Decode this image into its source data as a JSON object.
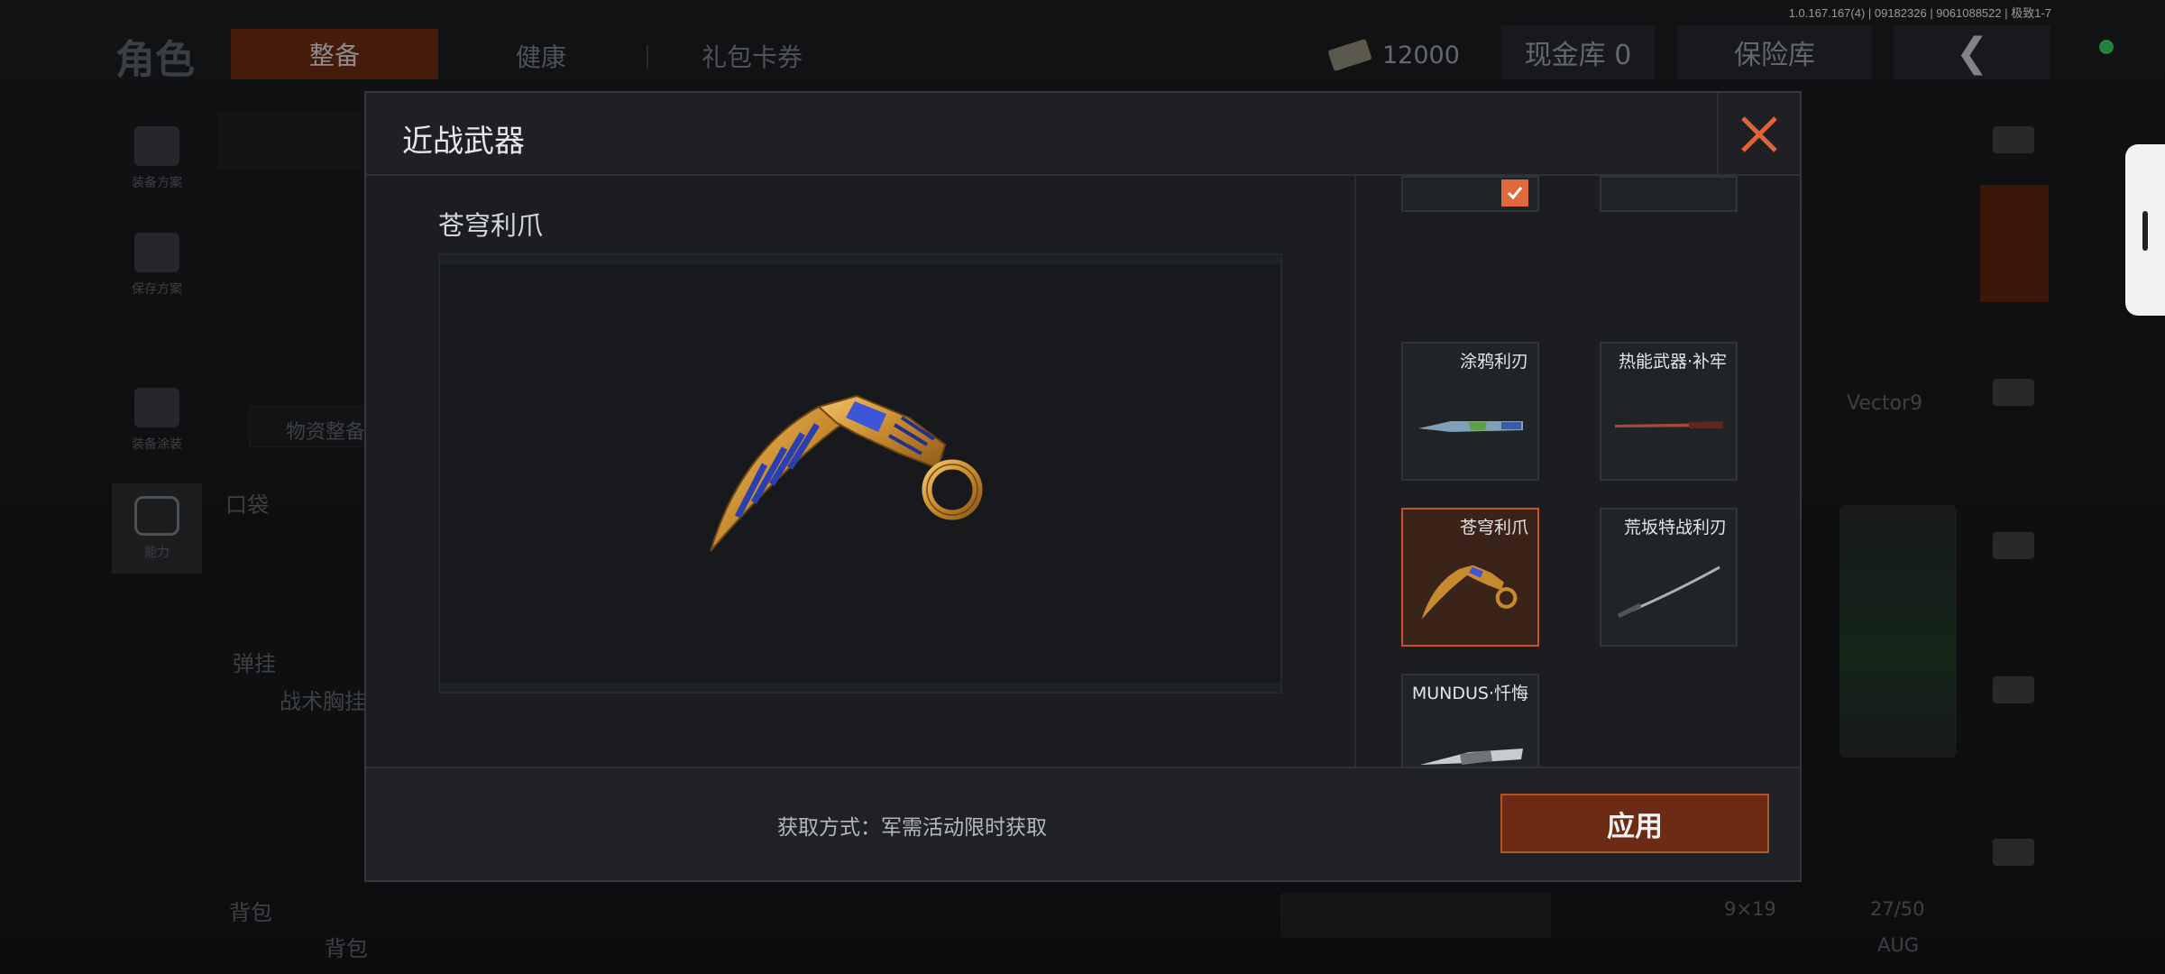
{
  "version": "1.0.167.167(4) | 09182326 | 9061088522 | 极致1-7",
  "background": {
    "title": "角色",
    "tabs": {
      "active": "整备",
      "health": "健康",
      "gift": "礼包卡券"
    },
    "money": "12000",
    "cash_vault": "现金库 0",
    "safe": "保险库",
    "back": "❮",
    "sidebar": [
      "装备方案",
      "保存方案",
      "装备涂装",
      "能力"
    ],
    "supply": "物资整备",
    "pocket": "口袋",
    "rig": "弹挂",
    "rig_sub": "战术胸挂",
    "backpack": "背包",
    "backpack_sub": "背包",
    "weapon_name": "Vector9",
    "ammo": "9×19",
    "ammo_count": "27/50",
    "weapon2": "AUG"
  },
  "modal": {
    "title": "近战武器",
    "preview_title": "苍穹利爪",
    "acquire_text": "获取方式：军需活动限时获取",
    "apply_label": "应用",
    "items": [
      {
        "name": "涂鸦利刃",
        "thumb": "graffiti-knife-icon",
        "selected": false
      },
      {
        "name": "热能武器·补牢",
        "thumb": "thermal-blade-icon",
        "selected": false
      },
      {
        "name": "苍穹利爪",
        "thumb": "karambit-gold-icon",
        "selected": true
      },
      {
        "name": "荒坂特战利刃",
        "thumb": "katana-icon",
        "selected": false
      },
      {
        "name": "MUNDUS·忏悔",
        "thumb": "silver-knife-icon",
        "selected": false
      }
    ]
  },
  "colors": {
    "accent": "#e0683a",
    "apply_bg": "#6d2a14",
    "selected_border": "#c6542b",
    "status_green": "#35c759"
  }
}
